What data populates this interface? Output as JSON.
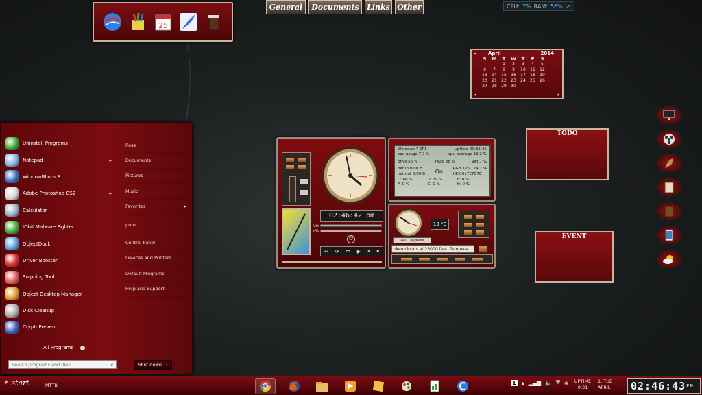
{
  "tabs": [
    "General",
    "Documents",
    "Links",
    "Other"
  ],
  "monitor": {
    "cpu_label": "CPU:",
    "cpu": "7%",
    "ram_label": "RAM:",
    "ram": "56%"
  },
  "top_dock": {
    "icons": [
      "google-earth-icon",
      "paint-icon",
      "calendar-icon",
      "feather-icon",
      "trash-icon"
    ],
    "calendar_day": "25"
  },
  "calendar": {
    "month": "April",
    "year": "2014",
    "days_of_week": [
      "S",
      "M",
      "T",
      "W",
      "T",
      "F",
      "S"
    ],
    "rows": [
      [
        "",
        "",
        "1",
        "2",
        "3",
        "4",
        "5"
      ],
      [
        "6",
        "7",
        "8",
        "9",
        "10",
        "11",
        "12"
      ],
      [
        "13",
        "14",
        "15",
        "16",
        "17",
        "18",
        "19"
      ],
      [
        "20",
        "21",
        "22",
        "23",
        "24",
        "25",
        "26"
      ],
      [
        "27",
        "28",
        "29",
        "30",
        "",
        "",
        ""
      ]
    ]
  },
  "todo": {
    "title": "TODO"
  },
  "event": {
    "title": "EVENT"
  },
  "right_dock": [
    "monitor-icon",
    "film-reel-icon",
    "horn-icon",
    "book-icon",
    "notebook-icon",
    "tablet-icon",
    "weather-icon"
  ],
  "start_menu": {
    "programs": [
      {
        "label": "Uninstall Programs",
        "icon": "uninstall-icon",
        "color": "#3aa83a"
      },
      {
        "label": "Notepad",
        "icon": "notepad-icon",
        "color": "#7fb6e8",
        "submenu": true
      },
      {
        "label": "WindowBlinds 8",
        "icon": "windowblinds-icon",
        "color": "#3870c8"
      },
      {
        "label": "Adobe Photoshop CS2",
        "icon": "photoshop-icon",
        "color": "#d8d8d8",
        "submenu": true
      },
      {
        "label": "Calculator",
        "icon": "calculator-icon",
        "color": "#9ab4cc"
      },
      {
        "label": "IObit Malware Fighter",
        "icon": "iobit-icon",
        "color": "#40b040"
      },
      {
        "label": "ObjectDock",
        "icon": "objectdock-icon",
        "color": "#5aa0e0"
      },
      {
        "label": "Driver Booster",
        "icon": "driver-booster-icon",
        "color": "#d83030"
      },
      {
        "label": "Snipping Tool",
        "icon": "snipping-tool-icon",
        "color": "#e06060"
      },
      {
        "label": "Object Desktop Manager",
        "icon": "object-desktop-icon",
        "color": "#e0a030"
      },
      {
        "label": "Disk Cleanup",
        "icon": "disk-cleanup-icon",
        "color": "#b0b0b0"
      },
      {
        "label": "CryptoPrevent",
        "icon": "cryptoprevent-icon",
        "color": "#4060c0"
      }
    ],
    "places": [
      {
        "label": "Ross"
      },
      {
        "label": "Documents"
      },
      {
        "label": "Pictures"
      },
      {
        "label": "Music"
      },
      {
        "label": "Favorites",
        "submenu": true
      },
      {
        "label": "puter"
      },
      {
        "label": "Control Panel"
      },
      {
        "label": "Devices and Printers"
      },
      {
        "label": "Default Programs"
      },
      {
        "label": "Help and Support"
      }
    ],
    "all_programs": "All Programs",
    "search_placeholder": "Search programs and files",
    "shutdown": "Shut down"
  },
  "clock_widget": {
    "time": "02:46:42 pm",
    "vol_label": "vol",
    "pct_label": "r%"
  },
  "system_widget": {
    "os": "Windows 7 SP1",
    "uptime": "Uptime 00:31:45",
    "cpu_usage": "cpu usage 7.7 %",
    "cpu_average": "cpu average 13.2 %",
    "phys": "phys 56 %",
    "swap": "swap 36 %",
    "virt": "virt 7 %",
    "net_in": "net in 0.00 B",
    "net_out": "net out 0.00 B",
    "status": "On",
    "rgb": "RGB 126,124,124",
    "hex": "HEX 0x7E7C7C",
    "drives": [
      "C: 46 %",
      "D: 39 %",
      "E: 0 %",
      "F: 0 %",
      "G: 0 %",
      "H: 0 %"
    ]
  },
  "weather_widget": {
    "temp": "13 °C",
    "degrees": "240 Degrees",
    "ticker": "oken clouds at 23000 feet.  Tempera"
  },
  "taskbar": {
    "start": "start",
    "toolbar": "MTTB",
    "apps": [
      "chrome-icon",
      "firefox-icon",
      "explorer-folder-icon",
      "media-player-icon",
      "sticky-notes-icon",
      "paint-icon",
      "registry-icon",
      "ccleaner-icon"
    ],
    "tray_badge": "1",
    "uptime_label": "UPTIME",
    "uptime_value": "0:31",
    "date_line1": "1, TUE",
    "date_line2": "APRIL",
    "clock": "02:46:43",
    "clock_suffix": "PM"
  },
  "colors": {
    "accent": "#7a0c10",
    "frame": "#c7b79a",
    "screen": "#aeb7a8"
  }
}
